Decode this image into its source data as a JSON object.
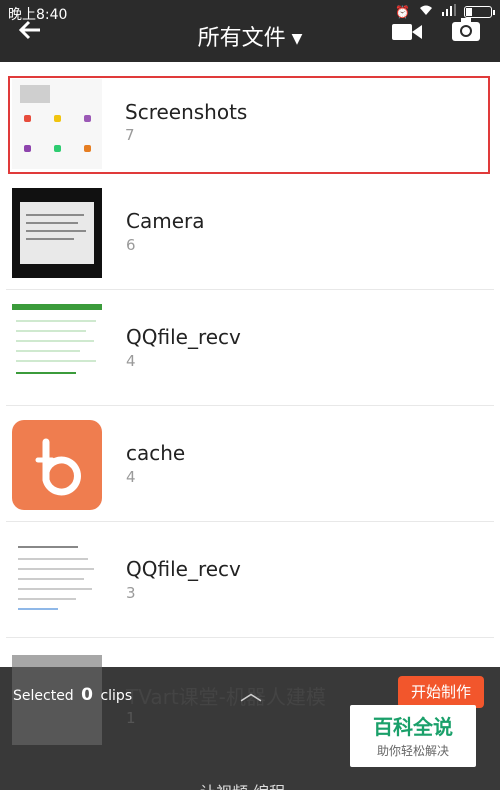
{
  "status": {
    "time": "晚上8:40"
  },
  "header": {
    "title": "所有文件"
  },
  "folders": [
    {
      "name": "Screenshots",
      "count": "7"
    },
    {
      "name": "Camera",
      "count": "6"
    },
    {
      "name": "QQfile_recv",
      "count": "4"
    },
    {
      "name": "cache",
      "count": "4"
    },
    {
      "name": "QQfile_recv",
      "count": "3"
    },
    {
      "name": "TVart课堂-机器人建模",
      "count": "1"
    }
  ],
  "bottom": {
    "selected_prefix": "Selected",
    "selected_count": "0",
    "selected_suffix": "clips",
    "start_button": "开始制作",
    "cut_text": "让视频·编程"
  },
  "watermark": {
    "title": "百科全说",
    "subtitle": "助你轻松解决"
  },
  "colors": {
    "accent": "#f2562c",
    "selection_border": "#e03a3a",
    "header_bg": "#2b2b2b",
    "watermark_green": "#1aa06a"
  }
}
